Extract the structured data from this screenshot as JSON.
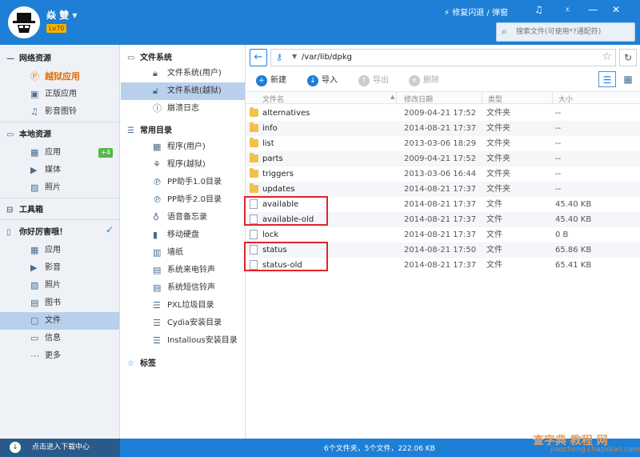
{
  "header": {
    "username": "焱 雙",
    "level": "Lv70",
    "repair": "修复闪退 / 弹窗",
    "search_placeholder": "搜索文件(可使用*?通配符)"
  },
  "sidebar": {
    "network_title": "网络资源",
    "network_items": [
      {
        "label": "越狱应用",
        "icon": "jailbreak-app-icon"
      },
      {
        "label": "正版应用",
        "icon": "bag-icon"
      },
      {
        "label": "影音图铃",
        "icon": "music-icon"
      }
    ],
    "local_title": "本地资源",
    "local_items": [
      {
        "label": "应用",
        "icon": "grid-icon",
        "badge": "+4"
      },
      {
        "label": "媒体",
        "icon": "video-icon"
      },
      {
        "label": "照片",
        "icon": "photo-icon"
      }
    ],
    "toolbox": "工具箱",
    "device_title": "你好厉害哦！",
    "device_items": [
      {
        "label": "应用",
        "icon": "grid-icon"
      },
      {
        "label": "影音",
        "icon": "video-icon"
      },
      {
        "label": "照片",
        "icon": "photo-icon"
      },
      {
        "label": "图书",
        "icon": "book-icon"
      },
      {
        "label": "文件",
        "icon": "file-icon"
      },
      {
        "label": "信息",
        "icon": "message-icon"
      },
      {
        "label": "更多",
        "icon": "more-icon"
      }
    ]
  },
  "tree": {
    "fs_title": "文件系统",
    "fs_items": [
      "文件系统(用户)",
      "文件系统(越狱)",
      "崩溃日志"
    ],
    "dirs_title": "常用目录",
    "dir_items": [
      "程序(用户)",
      "程序(越狱)",
      "PP助手1.0目录",
      "PP助手2.0目录",
      "语音备忘录",
      "移动硬盘",
      "墙纸",
      "系统来电铃声",
      "系统短信铃声",
      "PXL垃圾目录",
      "Cydia安装目录",
      "Installous安装目录"
    ],
    "tags": "标签"
  },
  "content": {
    "path": "/var/lib/dpkg",
    "toolbar": {
      "new": "新建",
      "import": "导入",
      "export": "导出",
      "delete": "删除"
    },
    "columns": {
      "name": "文件名",
      "date": "修改日期",
      "type": "类型",
      "size": "大小"
    },
    "rows": [
      {
        "name": "alternatives",
        "date": "2009-04-21 17:52",
        "type": "文件夹",
        "size": "--",
        "kind": "folder"
      },
      {
        "name": "info",
        "date": "2014-08-21 17:37",
        "type": "文件夹",
        "size": "--",
        "kind": "folder"
      },
      {
        "name": "list",
        "date": "2013-03-06 18:29",
        "type": "文件夹",
        "size": "--",
        "kind": "folder"
      },
      {
        "name": "parts",
        "date": "2009-04-21 17:52",
        "type": "文件夹",
        "size": "--",
        "kind": "folder"
      },
      {
        "name": "triggers",
        "date": "2013-03-06 16:44",
        "type": "文件夹",
        "size": "--",
        "kind": "folder"
      },
      {
        "name": "updates",
        "date": "2014-08-21 17:37",
        "type": "文件夹",
        "size": "--",
        "kind": "folder"
      },
      {
        "name": "available",
        "date": "2014-08-21 17:37",
        "type": "文件",
        "size": "45.40 KB",
        "kind": "file"
      },
      {
        "name": "available-old",
        "date": "2014-08-21 17:37",
        "type": "文件",
        "size": "45.40 KB",
        "kind": "file"
      },
      {
        "name": "lock",
        "date": "2014-08-21 17:37",
        "type": "文件",
        "size": "0 B",
        "kind": "file"
      },
      {
        "name": "status",
        "date": "2014-08-21 17:50",
        "type": "文件",
        "size": "65.86 KB",
        "kind": "file"
      },
      {
        "name": "status-old",
        "date": "2014-08-21 17:37",
        "type": "文件",
        "size": "65.41 KB",
        "kind": "file"
      }
    ]
  },
  "status": {
    "download_center": "点击进入下载中心",
    "summary": "6个文件夹，5个文件，222.06 KB"
  },
  "watermark": {
    "line1": "查字典 教程 网",
    "line2": "jiaocheng.chazidian.com"
  },
  "colors": {
    "header": "#1e7fd6",
    "selected": "#b8d0ec",
    "highlight_box": "#e0242b",
    "accent_orange": "#e86b00"
  }
}
